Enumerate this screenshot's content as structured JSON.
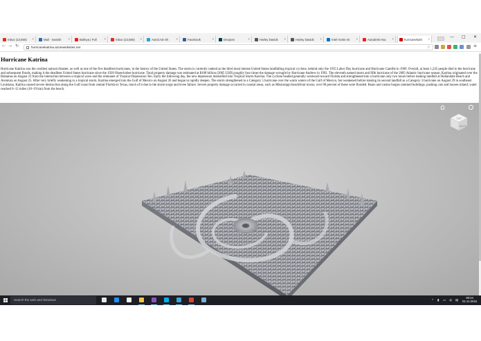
{
  "browser": {
    "tabs": [
      {
        "label": "Inbox (13,560)",
        "icon_color": "#d93025"
      },
      {
        "label": "Mail - manish",
        "icon_color": "#2b6cb0"
      },
      {
        "label": "Bulleya | Full",
        "icon_color": "#e62117"
      },
      {
        "label": "Inbox (13,560)",
        "icon_color": "#d93025"
      },
      {
        "label": "AutoCAD Sh",
        "icon_color": "#2a9fd6"
      },
      {
        "label": "Facebook",
        "icon_color": "#3b5998"
      },
      {
        "label": "Devpost",
        "icon_color": "#003e54"
      },
      {
        "label": "Harley Davids",
        "icon_color": "#555555"
      },
      {
        "label": "Harley Davids",
        "icon_color": "#555555"
      },
      {
        "label": "Intel Hosts Int",
        "icon_color": "#0071c5"
      },
      {
        "label": "Autodesk Hac",
        "icon_color": "#e62117"
      },
      {
        "label": "hurricanekatri",
        "icon_color": "#cc0000"
      }
    ],
    "url": "hurricanekatrina.azurewebsites.net",
    "window_controls": {
      "minimize": "—",
      "maximize": "□",
      "close": "✕"
    },
    "nav": {
      "back": "←",
      "forward": "→",
      "reload": "↻"
    }
  },
  "page": {
    "title": "Hurricane Katrina",
    "article": "Hurricane Katrina was the costliest natural disaster, as well as one of the five deadliest hurricanes, in the history of the United States. The storm is currently ranked as the third most intense United States landfalling tropical cyclone, behind only the 1935 Labor Day hurricane and Hurricane Camille in 1969. Overall, at least 1,245 people died in the hurricane and subsequent floods, making it the deadliest United States hurricane since the 1928 Okeechobee hurricane. Total property damage was estimated at $108 billion (2005 USD),roughly four times the damage wrought by Hurricane Andrew in 1992. The eleventh named storm and fifth hurricane of the 2005 Atlantic hurricane season, Katrina originated over the Bahamas on August 23 from the interaction between a tropical wave and the remnants of Tropical Depression Ten. Early the following day, the new depression intensified into Tropical Storm Katrina. The cyclone headed generally westward toward Florida and strengthened into a hurricane only two hours before making landfall at Hallandale Beach and Aventura on August 25. After very briefly weakening to a tropical storm, Katrina emerged into the Gulf of Mexico on August 26 and began to rapidly deepen. The storm strengthened to a Category 5 hurricane over the warm waters of the Gulf of Mexico, but weakened before making its second landfall as a Category 3 hurricane on August 29 in southeast Louisiana. Katrina caused severe destruction along the Gulf coast from central Florida to Texas, much of it due to the storm surge and levee failure. Severe property damage occurred in coastal areas, such as Mississippi beachfront towns; over 90 percent of these were flooded. Boats and casino barges rammed buildings, pushing cars and houses inland; water reached 6–12 miles (10–19 km) from the beach."
  },
  "viewer": {
    "viewcube_labels": {
      "top": "TOP",
      "front": "BACK"
    },
    "background": "#bdbdbd",
    "terrain_color": "#8e9098"
  },
  "taskbar": {
    "search_placeholder": "Search the web and Windows",
    "apps": [
      {
        "name": "task-view-icon",
        "color": "#e6e6e6"
      },
      {
        "name": "edge-icon",
        "color": "#1e90ff"
      },
      {
        "name": "store-icon",
        "color": "#f2f2f2"
      },
      {
        "name": "file-explorer-icon",
        "color": "#f4c542"
      },
      {
        "name": "visual-studio-icon",
        "color": "#8a52c7"
      },
      {
        "name": "skype-icon",
        "color": "#00aff0"
      },
      {
        "name": "app-icon",
        "color": "#3fa0d8"
      },
      {
        "name": "chrome-icon",
        "color": "#db4437"
      },
      {
        "name": "app2-icon",
        "color": "#7bb0d6"
      }
    ],
    "time": "00:44",
    "date": "01-11-2016"
  }
}
